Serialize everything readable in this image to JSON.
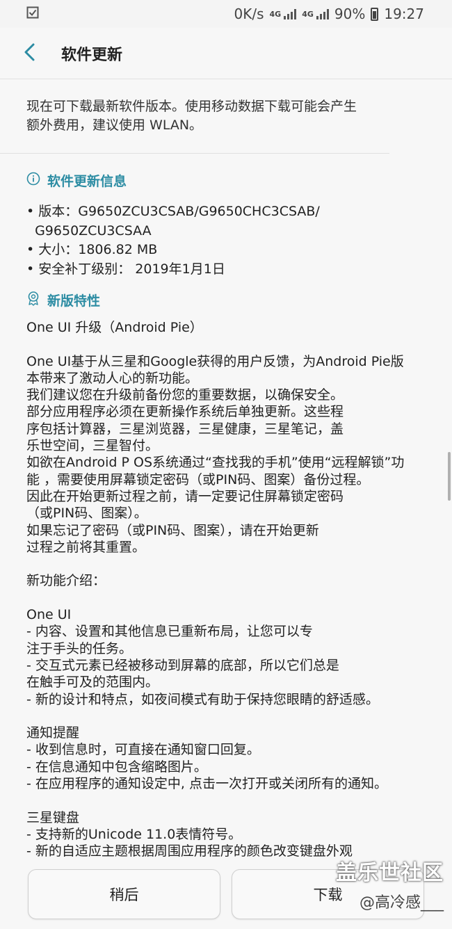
{
  "status_bar": {
    "net_speed": "0K/s",
    "net_type_1": "4G",
    "net_type_2": "4G",
    "battery": "90%",
    "time": "19:27"
  },
  "header": {
    "title": "软件更新"
  },
  "intro_text": "现在可下载最新软件版本。使用移动数据下载可能会产生额外费用，建议使用 WLAN。",
  "update_info": {
    "title": "软件更新信息",
    "lines": [
      "• 版本：G9650ZCU3CSAB/G9650CHC3CSAB/",
      "  G9650ZCU3CSAA",
      "• 大小：1806.82 MB",
      "• 安全补丁级别： 2019年1月1日"
    ]
  },
  "features": {
    "title": "新版特性",
    "lines": [
      "One UI 升级（Android Pie）",
      "",
      "One UI基于从三星和Google获得的用户反馈，为Android Pie版",
      "本带来了激动人心的新功能。",
      "我们建议您在升级前备份您的重要数据，以确保安全。",
      "部分应用程序必须在更新操作系统后单独更新。这些程",
      "序包括计算器，三星浏览器，三星健康，三星笔记，盖",
      "乐世空间，三星智付。",
      "如欲在Android P OS系统通过“查找我的手机”使用“远程解锁”功",
      "能 ，需要使用屏幕锁定密码（或PIN码、图案）备份过程。",
      "因此在开始更新过程之前，请一定要记住屏幕锁定密码",
      "（或PIN码、图案）。",
      "如果忘记了密码（或PIN码、图案），请在开始更新",
      "过程之前将其重置。",
      "",
      "新功能介绍：",
      "",
      "One UI",
      "- 内容、设置和其他信息已重新布局，让您可以专",
      "注于手头的任务。",
      "- 交互式元素已经被移动到屏幕的底部，所以它们总是",
      "在触手可及的范围内。",
      "- 新的设计和特点，如夜间模式有助于保持您眼睛的舒适感。",
      "",
      "通知提醒",
      "- 收到信息时，可直接在通知窗口回复。",
      "- 在信息通知中包含缩略图片。",
      "- 在应用程序的通知设定中, 点击一次打开或关闭所有的通知。",
      "",
      "三星键盘",
      "- 支持新的Unicode 11.0表情符号。",
      "- 新的自适应主题根据周围应用程序的颜色改变键盘外观"
    ]
  },
  "buttons": {
    "later": "稍后",
    "download": "下载"
  },
  "watermark": {
    "site": "盖乐世社区",
    "user": "@高冷感___"
  },
  "colors": {
    "accent": "#2c8ca3",
    "background": "#f7f7f7"
  }
}
